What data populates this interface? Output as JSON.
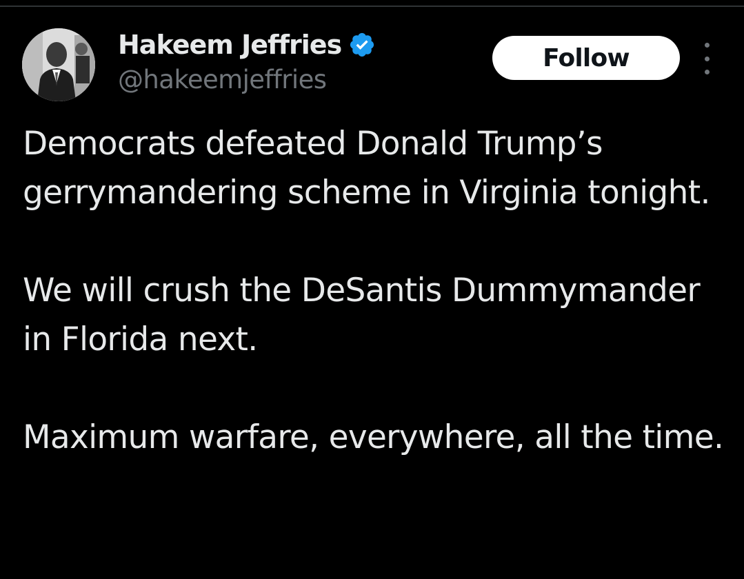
{
  "author": {
    "display_name": "Hakeem Jeffries",
    "handle": "@hakeemjeffries",
    "verified": true,
    "verified_color": "#1d9bf0"
  },
  "actions": {
    "follow_label": "Follow",
    "more_icon": "more-vertical-icon"
  },
  "tweet": {
    "paragraphs": [
      "Democrats defeated Donald Trump’s gerrymandering scheme in Virginia tonight.",
      "We will crush the DeSantis Dummymander in Florida next.",
      "Maximum warfare, everywhere, all the time."
    ]
  },
  "theme": {
    "background": "#000000",
    "text": "#e7e9ea",
    "secondary_text": "#71767b",
    "button_bg": "#ffffff",
    "button_text": "#0f1419"
  }
}
